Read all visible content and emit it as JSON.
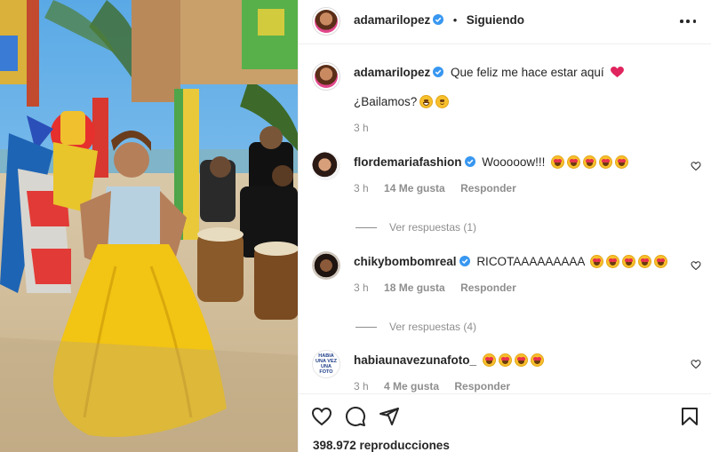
{
  "header": {
    "username": "adamarilopez",
    "separator": "•",
    "follow_label": "Siguiendo"
  },
  "caption": {
    "username": "adamarilopez",
    "text": "Que feliz me hace estar aquí",
    "line2": "¿Bailamos?",
    "time": "3 h"
  },
  "comments": [
    {
      "username": "flordemariafashion",
      "text": "Wooooow!!!",
      "time": "3 h",
      "likes": "14 Me gusta",
      "reply_label": "Responder",
      "view_replies": "Ver respuestas (1)",
      "emoji_count": 5,
      "avatar_color": "#3b2a2a"
    },
    {
      "username": "chikybombomreal",
      "text": "RICOTAAAAAAAAA",
      "time": "3 h",
      "likes": "18 Me gusta",
      "reply_label": "Responder",
      "view_replies": "Ver respuestas (4)",
      "emoji_count": 5,
      "avatar_color": "#5a3b24"
    },
    {
      "username": "habiaunavezunafoto_",
      "text": "",
      "time": "3 h",
      "likes": "4 Me gusta",
      "reply_label": "Responder",
      "emoji_count": 4,
      "avatar_text": "HABIA UNA VEZ UNA FOTO",
      "avatar_color": "#1f3e8a"
    }
  ],
  "footer": {
    "views": "398.972 reproducciones"
  },
  "icons": {
    "more": "more-options-icon",
    "like": "heart-outline-icon",
    "comment": "comment-bubble-icon",
    "share": "paper-plane-icon",
    "save": "bookmark-icon",
    "verified": "verified-badge-icon",
    "comment_like": "small-heart-icon"
  },
  "colors": {
    "verified": "#3897f0",
    "text_secondary": "#8e8e8e",
    "heart_red": "#e0245e",
    "dress_yellow": "#f2c414"
  }
}
